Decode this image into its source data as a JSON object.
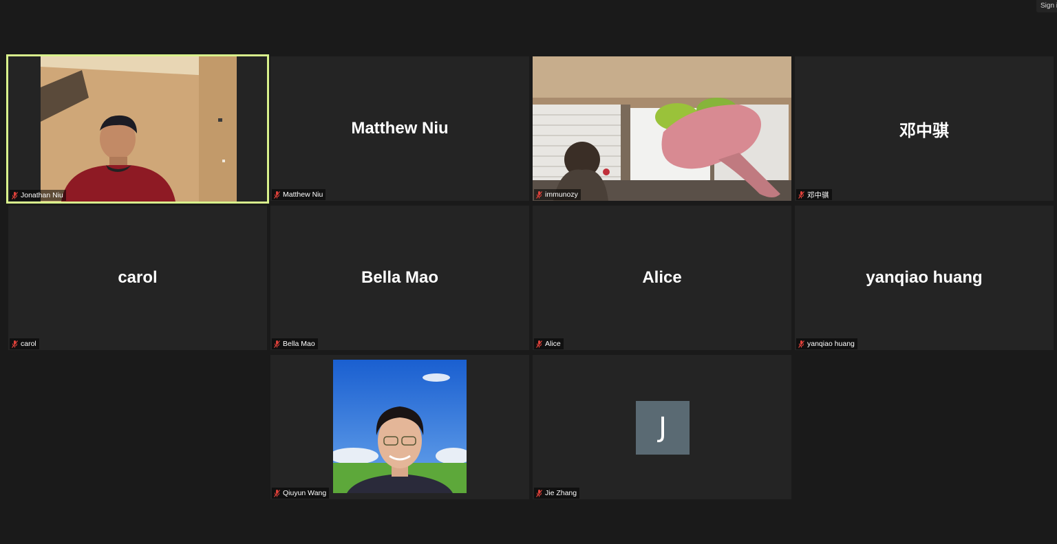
{
  "window": {
    "sign_in_label": "Sign in"
  },
  "participants": [
    {
      "name": "Jonathan Niu",
      "label": "Jonathan Niu",
      "video": true,
      "active_speaker": true,
      "muted": true
    },
    {
      "name": "Matthew Niu",
      "label": "Matthew Niu",
      "video": false,
      "muted": true
    },
    {
      "name": "immunozy",
      "label": "immunozy",
      "video": true,
      "muted": true
    },
    {
      "name": "邓中骐",
      "label": "邓中骐",
      "video": false,
      "muted": true
    },
    {
      "name": "carol",
      "label": "carol",
      "video": false,
      "muted": true
    },
    {
      "name": "Bella Mao",
      "label": "Bella Mao",
      "video": false,
      "muted": true
    },
    {
      "name": "Alice",
      "label": "Alice",
      "video": false,
      "muted": true
    },
    {
      "name": "yanqiao huang",
      "label": "yanqiao huang",
      "video": false,
      "muted": true
    },
    {
      "name": "Qiuyun Wang",
      "label": "Qiuyun Wang",
      "video": true,
      "muted": true
    },
    {
      "name": "Jie Zhang",
      "label": "Jie Zhang",
      "video": false,
      "initial": "J",
      "muted": true
    }
  ],
  "colors": {
    "background": "#1a1a1a",
    "tile": "#242424",
    "active_speaker_border": "#d9f28c",
    "muted_icon": "#e0413a",
    "avatar_bg": "#5a6a73"
  },
  "icons": {
    "muted": "mic-muted-icon"
  }
}
